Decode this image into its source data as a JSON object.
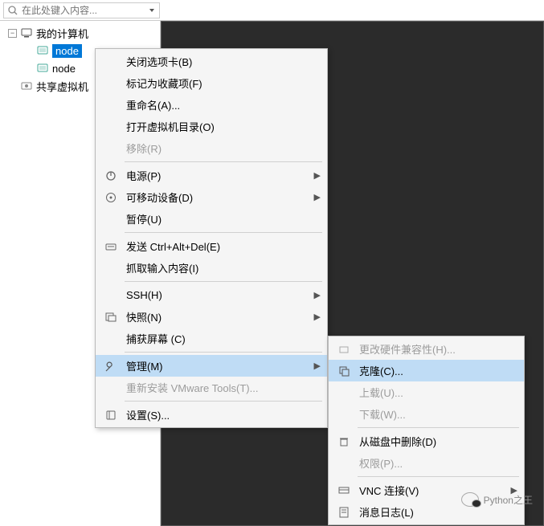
{
  "search": {
    "placeholder": "在此处键入内容..."
  },
  "tree": {
    "root": "我的计算机",
    "node1": "node",
    "node2": "node",
    "shared": "共享虚拟机"
  },
  "menu": {
    "close_tab": "关闭选项卡(B)",
    "mark_fav": "标记为收藏项(F)",
    "rename": "重命名(A)...",
    "open_dir": "打开虚拟机目录(O)",
    "remove": "移除(R)",
    "power": "电源(P)",
    "removable": "可移动设备(D)",
    "pause": "暂停(U)",
    "send_cad": "发送 Ctrl+Alt+Del(E)",
    "grab_input": "抓取输入内容(I)",
    "ssh": "SSH(H)",
    "snapshot": "快照(N)",
    "capture": "捕获屏幕 (C)",
    "manage": "管理(M)",
    "reinstall": "重新安装 VMware Tools(T)...",
    "settings": "设置(S)..."
  },
  "submenu": {
    "change_hw": "更改硬件兼容性(H)...",
    "clone": "克隆(C)...",
    "upload": "上载(U)...",
    "download": "下载(W)...",
    "delete_disk": "从磁盘中删除(D)",
    "permissions": "权限(P)...",
    "vnc": "VNC 连接(V)",
    "msglog": "消息日志(L)"
  },
  "watermark": "Python之王"
}
